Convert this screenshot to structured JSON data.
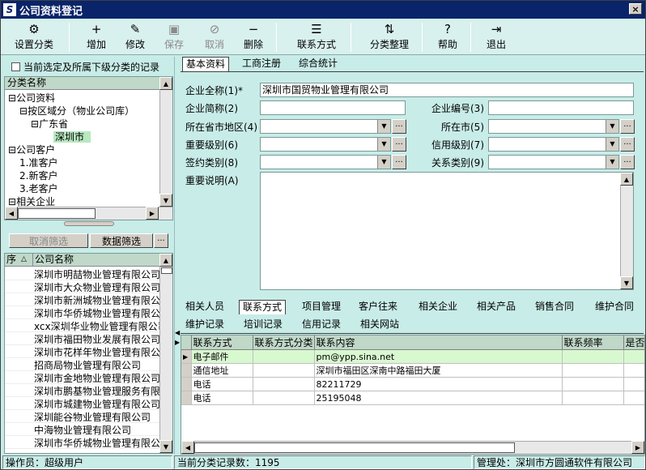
{
  "window": {
    "title": "公司资料登记",
    "icon": "S",
    "close": "×"
  },
  "toolbar": [
    {
      "label": "设置分类",
      "icon": "category-icon",
      "glyph": "⚙",
      "enabled": true
    },
    {
      "label": "增加",
      "icon": "add-icon",
      "glyph": "+",
      "enabled": true
    },
    {
      "label": "修改",
      "icon": "edit-icon",
      "glyph": "✎",
      "enabled": true
    },
    {
      "label": "保存",
      "icon": "save-icon",
      "glyph": "▣",
      "enabled": false
    },
    {
      "label": "取消",
      "icon": "cancel-icon",
      "glyph": "⊘",
      "enabled": false
    },
    {
      "label": "删除",
      "icon": "delete-icon",
      "glyph": "−",
      "enabled": true
    },
    {
      "label": "联系方式",
      "icon": "list-icon",
      "glyph": "☰",
      "enabled": true
    },
    {
      "label": "分类整理",
      "icon": "organize-icon",
      "glyph": "⇅",
      "enabled": true
    },
    {
      "label": "帮助",
      "icon": "help-icon",
      "glyph": "?",
      "enabled": true
    },
    {
      "label": "退出",
      "icon": "exit-icon",
      "glyph": "⇥",
      "enabled": true
    }
  ],
  "left": {
    "checkbox_label": "当前选定及所属下级分类的记录",
    "tree_header": "分类名称",
    "tree": [
      {
        "text": "公司资料",
        "toggle": "⊟",
        "level": 0
      },
      {
        "text": "按区域分（物业公司库）",
        "toggle": "⊟",
        "level": 1
      },
      {
        "text": "广东省",
        "toggle": "⊟",
        "level": 2
      },
      {
        "text": "深圳市",
        "toggle": "",
        "level": 3,
        "selected": true
      },
      {
        "text": "公司客户",
        "toggle": "⊟",
        "level": 0
      },
      {
        "text": "1.准客户",
        "toggle": "",
        "level": 1
      },
      {
        "text": "2.新客户",
        "toggle": "",
        "level": 1
      },
      {
        "text": "3.老客户",
        "toggle": "",
        "level": 1
      },
      {
        "text": "相关企业",
        "toggle": "⊟",
        "level": 0
      }
    ],
    "cancel_filter": "取消筛选",
    "data_filter": "数据筛选",
    "ellipsis": "···",
    "list_header_seq": "序",
    "list_header_sort": "△",
    "list_header_name": "公司名称",
    "companies": [
      "深圳市明喆物业管理有限公司",
      "深圳市大众物业管理有限公司",
      "深圳市新洲城物业管理有限公司",
      "深圳市华侨城物业管理有限公司",
      "xcx深圳华业物业管理有限公司",
      "深圳市福田物业发展有限公司",
      "深圳市花样年物业管理有限公司",
      "招商局物业管理有限公司",
      "深圳市金地物业管理有限公司",
      "深圳市鹏基物业管理服务有限公司",
      "深圳市城建物业管理有限公司",
      "深圳能谷物业管理有限公司",
      "中海物业管理有限公司",
      "深圳市华侨城物业管理有限公司"
    ]
  },
  "main_tabs": [
    "基本资料",
    "工商注册",
    "综合统计"
  ],
  "form": {
    "full_name_label": "企业全称(1)*",
    "full_name": "深圳市国贸物业管理有限公司",
    "short_name_label": "企业简称(2)",
    "short_name": "",
    "code_label": "企业编号(3)",
    "code": "",
    "region_label": "所在省市地区(4)",
    "region": "",
    "city_label": "所在市(5)",
    "city": "",
    "importance_label": "重要级别(6)",
    "importance": "",
    "credit_label": "信用级别(7)",
    "credit": "",
    "contract_label": "签约类别(8)",
    "contract": "",
    "relation_label": "关系类别(9)",
    "relation": "",
    "notes_label": "重要说明(A)",
    "notes": ""
  },
  "sub_tabs_row1": [
    "相关人员",
    "联系方式",
    "项目管理",
    "客户往来",
    "相关企业",
    "相关产品",
    "销售合同",
    "维护合同"
  ],
  "sub_tabs_row2": [
    "维护记录",
    "培训记录",
    "信用记录",
    "相关网站"
  ],
  "contact_grid": {
    "headers": [
      "联系方式",
      "联系方式分类",
      "联系内容",
      "联系频率",
      "是否"
    ],
    "rows": [
      [
        "电子邮件",
        "",
        "pm@ypp.sina.net",
        "",
        ""
      ],
      [
        "通信地址",
        "",
        "深圳市福田区深南中路福田大厦",
        "",
        ""
      ],
      [
        "电话",
        "",
        "82211729",
        "",
        ""
      ],
      [
        "电话",
        "",
        "25195048",
        "",
        ""
      ]
    ]
  },
  "status": {
    "operator": "操作员：超级用户",
    "records": "当前分类记录数：1195",
    "admin": "管理处：深圳市方圆通软件有限公司"
  }
}
